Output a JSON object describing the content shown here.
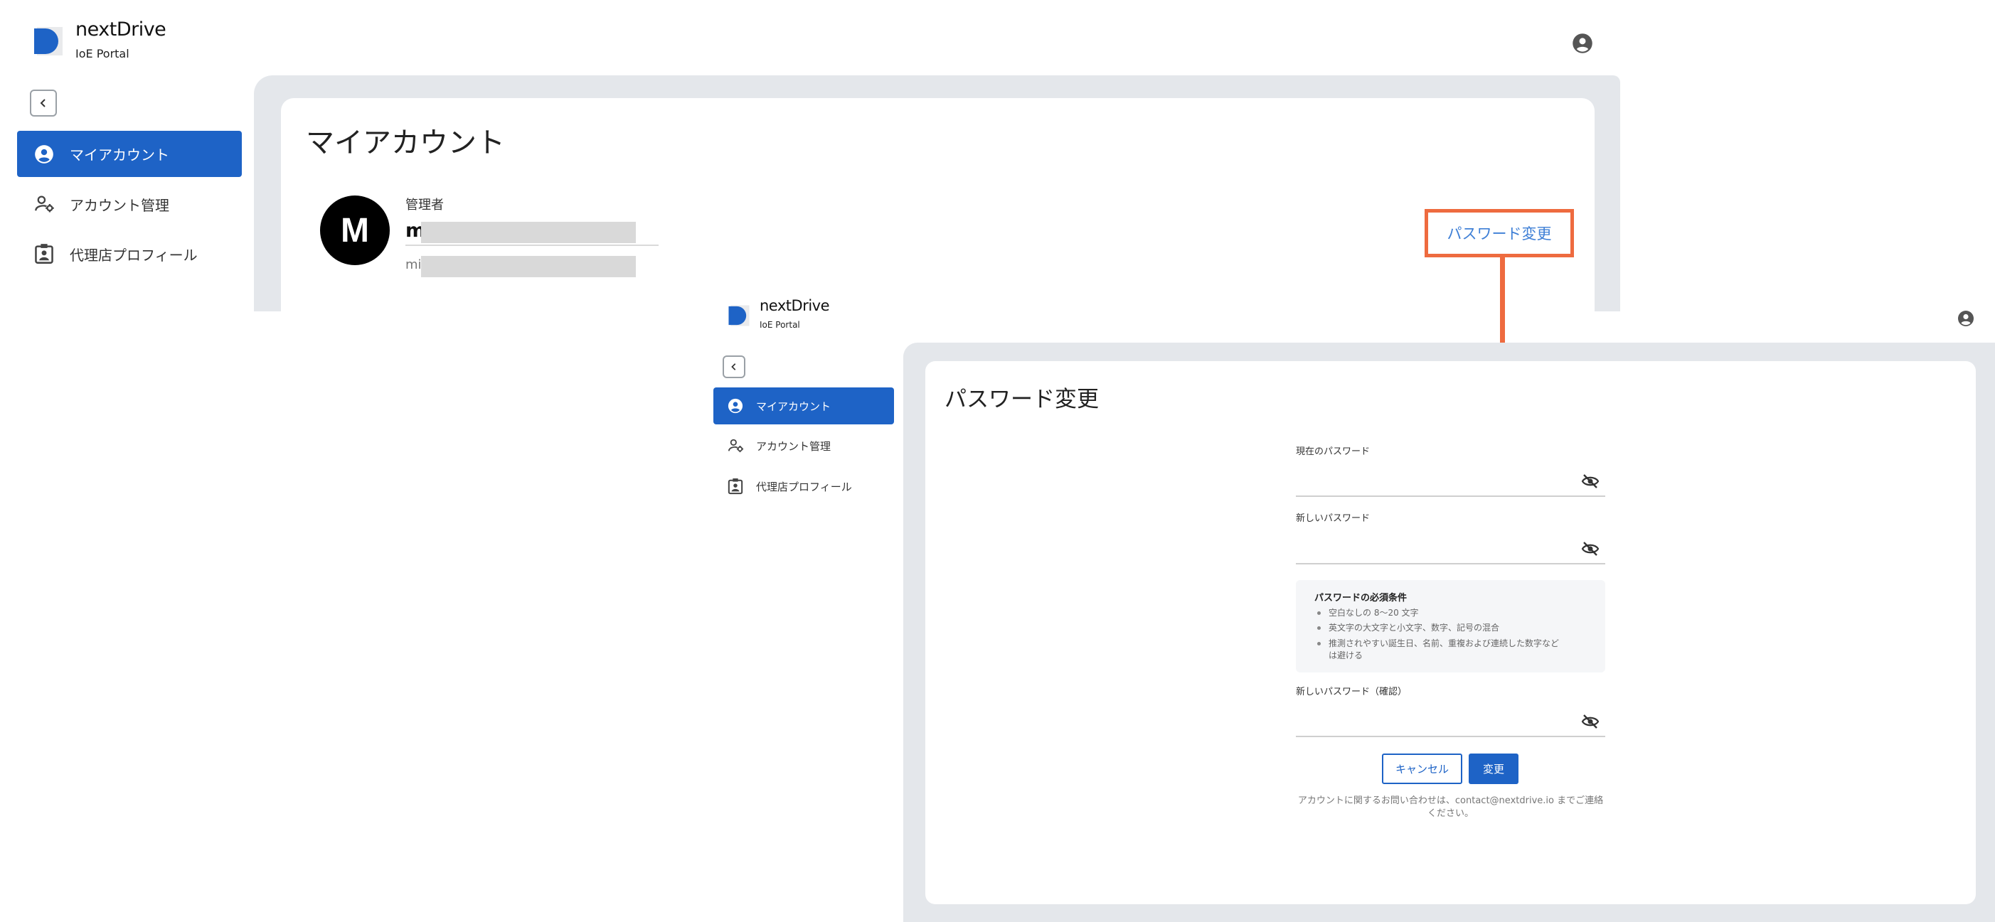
{
  "colors": {
    "primary": "#1e63c6",
    "highlight": "#ee6b3f",
    "link": "#3e7fd6",
    "panel_bg": "#e4e7eb"
  },
  "screen1": {
    "brand": {
      "name": "nextDrive",
      "subtitle": "IoE Portal"
    },
    "nav": [
      {
        "label": "マイアカウント",
        "icon": "account-circle-icon",
        "active": true
      },
      {
        "label": "アカウント管理",
        "icon": "manage-accounts-icon",
        "active": false
      },
      {
        "label": "代理店プロフィール",
        "icon": "contact-badge-icon",
        "active": false
      }
    ],
    "page_title": "マイアカウント",
    "avatar_letter": "M",
    "role": "管理者",
    "name_prefix": "m",
    "email_prefix": "mil",
    "password_change_label": "パスワード変更"
  },
  "screen2": {
    "brand": {
      "name": "nextDrive",
      "subtitle": "IoE Portal"
    },
    "nav": [
      {
        "label": "マイアカウント",
        "icon": "account-circle-icon",
        "active": true
      },
      {
        "label": "アカウント管理",
        "icon": "manage-accounts-icon",
        "active": false
      },
      {
        "label": "代理店プロフィール",
        "icon": "contact-badge-icon",
        "active": false
      }
    ],
    "page_title": "パスワード変更",
    "fields": {
      "current_password_label": "現在のパスワード",
      "new_password_label": "新しいパスワード",
      "confirm_password_label": "新しいパスワード（確認）"
    },
    "requirements": {
      "title": "パスワードの必須条件",
      "items": [
        "空白なしの 8～20 文字",
        "英文字の大文字と小文字、数字、記号の混合",
        "推測されやすい誕生日、名前、重複および連続した数字など",
        "は避ける"
      ]
    },
    "cancel_label": "キャンセル",
    "submit_label": "変更",
    "contact_line1": "アカウントに関するお問い合わせは、contact@nextdrive.io までご連絡",
    "contact_line2": "ください。"
  }
}
